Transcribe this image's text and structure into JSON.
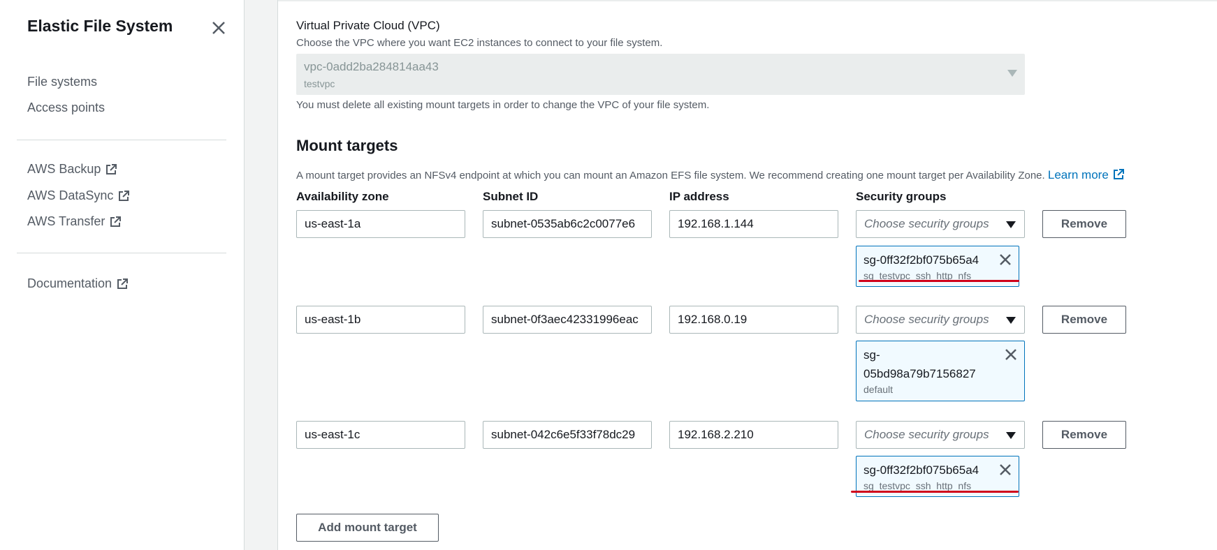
{
  "sidebar": {
    "title": "Elastic File System",
    "items": [
      {
        "label": "File systems"
      },
      {
        "label": "Access points"
      },
      {
        "label": "AWS Backup"
      },
      {
        "label": "AWS DataSync"
      },
      {
        "label": "AWS Transfer"
      },
      {
        "label": "Documentation"
      }
    ]
  },
  "vpc": {
    "label": "Virtual Private Cloud (VPC)",
    "description": "Choose the VPC where you want EC2 instances to connect to your file system.",
    "value": "vpc-0add2ba284814aa43",
    "value_sub": "testvpc",
    "note": "You must delete all existing mount targets in order to change the VPC of your file system."
  },
  "mount_targets": {
    "title": "Mount targets",
    "description": "A mount target provides an NFSv4 endpoint at which you can mount an Amazon EFS file system. We recommend creating one mount target per Availability Zone.",
    "learn_more": "Learn more",
    "headers": {
      "az": "Availability zone",
      "subnet": "Subnet ID",
      "ip": "IP address",
      "sg": "Security groups"
    },
    "sg_placeholder": "Choose security groups",
    "remove_label": "Remove",
    "add_label": "Add mount target",
    "rows": [
      {
        "az": "us-east-1a",
        "subnet": "subnet-0535ab6c2c0077e6",
        "ip": "192.168.1.144",
        "sg_name": "sg-0ff32f2bf075b65a4",
        "sg_desc": "sg_testvpc_ssh_http_nfs"
      },
      {
        "az": "us-east-1b",
        "subnet": "subnet-0f3aec42331996eac",
        "ip": "192.168.0.19",
        "sg_name_1": "sg-",
        "sg_name_2": "05bd98a79b7156827",
        "sg_desc": "default"
      },
      {
        "az": "us-east-1c",
        "subnet": "subnet-042c6e5f33f78dc29",
        "ip": "192.168.2.210",
        "sg_name": "sg-0ff32f2bf075b65a4",
        "sg_desc": "sg_testvpc_ssh_http_nfs"
      }
    ]
  },
  "colors": {
    "accent": "#0073bb",
    "annotation": "#d0021b"
  }
}
